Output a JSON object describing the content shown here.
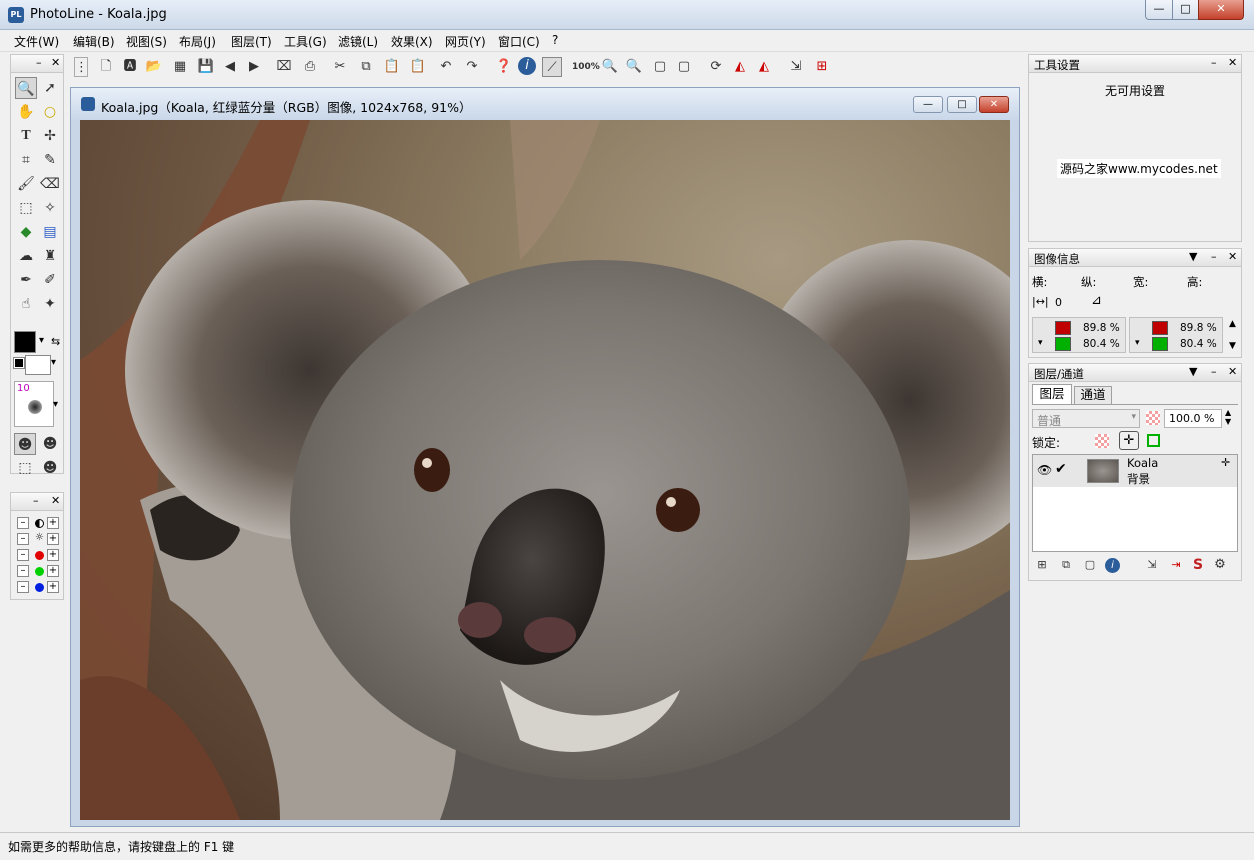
{
  "window": {
    "title": "PhotoLine - Koala.jpg"
  },
  "menu": [
    "文件(W)",
    "编辑(B)",
    "视图(S)",
    "布局(J)",
    "图层(T)",
    "工具(G)",
    "滤镜(L)",
    "效果(X)",
    "网页(Y)",
    "窗口(C)",
    "?"
  ],
  "toolbar": {
    "zoom_label": "100%"
  },
  "document": {
    "title": "Koala.jpg（Koala, 红绿蓝分量（RGB）图像, 1024x768, 91%）"
  },
  "brush": {
    "size": "10"
  },
  "tool_settings": {
    "title": "工具设置",
    "message": "无可用设置",
    "watermark": "源码之家www.mycodes.net"
  },
  "image_info": {
    "title": "图像信息",
    "labels": [
      "横:",
      "纵:",
      "宽:",
      "高:"
    ],
    "offset_value": "0",
    "left": {
      "red": "89.8 %",
      "green": "80.4 %"
    },
    "right": {
      "red": "89.8 %",
      "green": "80.4 %"
    }
  },
  "layers": {
    "title": "图层/通道",
    "tabs": [
      "图层",
      "通道"
    ],
    "blend_mode": "普通",
    "opacity": "100.0 %",
    "lock_label": "锁定:",
    "items": [
      {
        "name": "Koala",
        "subtitle": "背景"
      }
    ]
  },
  "status": {
    "text": "如需更多的帮助信息，请按键盘上的 F1 键"
  },
  "colors": {
    "accent": "#2b5d9a",
    "close": "#c4412b",
    "red_swatch": "#c00000",
    "green_swatch": "#00b000"
  }
}
